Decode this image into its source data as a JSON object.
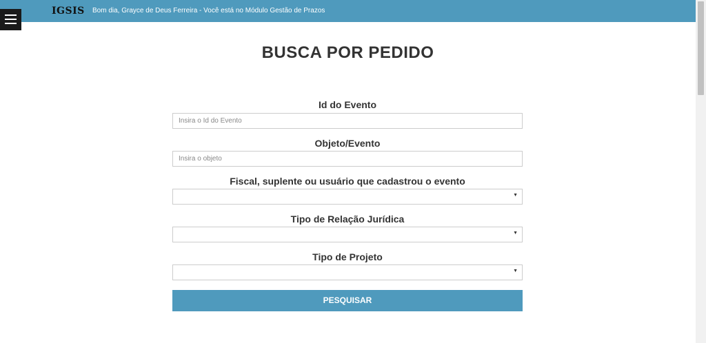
{
  "header": {
    "logo": "IGSIS",
    "greeting": "Bom dia, Grayce de Deus Ferreira - Você está no Módulo Gestão de Prazos"
  },
  "page": {
    "title": "BUSCA POR PEDIDO"
  },
  "form": {
    "id_evento": {
      "label": "Id do Evento",
      "placeholder": "Insira o Id do Evento",
      "value": ""
    },
    "objeto": {
      "label": "Objeto/Evento",
      "placeholder": "Insira o objeto",
      "value": ""
    },
    "fiscal": {
      "label": "Fiscal, suplente ou usuário que cadastrou o evento",
      "selected": ""
    },
    "relacao": {
      "label": "Tipo de Relação Jurídica",
      "selected": ""
    },
    "projeto": {
      "label": "Tipo de Projeto",
      "selected": ""
    },
    "submit_label": "PESQUISAR"
  },
  "colors": {
    "accent": "#4f9abd",
    "menu_button": "#1a1a1a"
  },
  "icons": {
    "menu": "hamburger-icon",
    "select": "triangle-down-icon"
  }
}
